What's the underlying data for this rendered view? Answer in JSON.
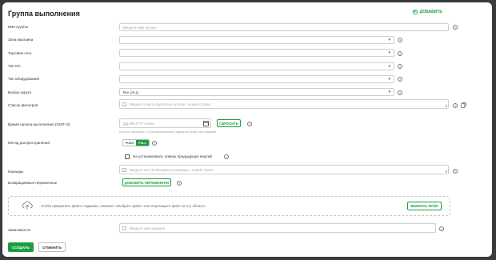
{
  "header": {
    "title": "Группа выполнения",
    "add_label": "добавить"
  },
  "rows": [
    {
      "label": "Имя группы",
      "placeholder": "Введите имя группы"
    },
    {
      "label": "Зона магазина",
      "value": ""
    },
    {
      "label": "Торговая сеть",
      "value": ""
    },
    {
      "label": "Тип ОС",
      "value": ""
    },
    {
      "label": "Тип оборудования",
      "value": ""
    },
    {
      "label": "Выбор округа",
      "value": "Все (ALL)"
    },
    {
      "label": "Список фильтров",
      "placeholder": "Введите список фильтров exclude с новой строки"
    },
    {
      "label": "Время начала выполнения (GMT+3)",
      "placeholder": "ДД.ММ.ГГГГ чч:мм",
      "hint": "Если не заполнено, то система выполнит задачу как сразу при создании",
      "reset_label": "сбросить"
    },
    {
      "label": "Метод распространения",
      "options": [
        "push",
        "pull"
      ],
      "selected": "pull"
    },
    {
      "label": "Не устанавливать поверх предыдущих версий"
    },
    {
      "label": "Команды",
      "placeholder": "Введите все необходимые команды с новой строки"
    },
    {
      "label": "Возвращаемые переменные",
      "button": "добавить переменную"
    },
    {
      "label": "Зависимости",
      "placeholder": "Введите имя задания"
    }
  ],
  "dropzone": {
    "text": "Чтобы прикрепить файл к заданию, нажмите «Выбрать файл» или перетащите файл на эту область",
    "button": "выбрать файл"
  },
  "footer": {
    "create": "создать",
    "cancel": "отменить"
  },
  "icons": {
    "help": "?",
    "chevron": "▾"
  },
  "colors": {
    "accent": "#1a9d3f"
  }
}
